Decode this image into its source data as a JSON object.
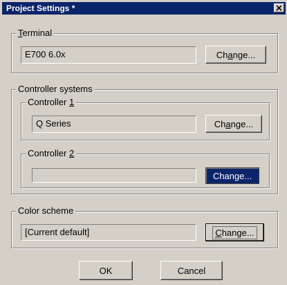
{
  "window": {
    "title": "Project Settings *",
    "close_icon": "close-icon"
  },
  "terminal": {
    "group_label_underlined": "T",
    "group_label_rest": "erminal",
    "value": "E700 6.0x",
    "change_label_pre": "Ch",
    "change_label_ul": "a",
    "change_label_post": "nge..."
  },
  "controller_systems": {
    "group_label": "Controller systems",
    "controller1": {
      "label_pre": "Controller ",
      "label_ul": "1",
      "value": "Q Series",
      "change_label_pre": "Ch",
      "change_label_ul": "a",
      "change_label_post": "nge..."
    },
    "controller2": {
      "label_pre": "Controller ",
      "label_ul": "2",
      "value": "",
      "change_label": "Change..."
    }
  },
  "color_scheme": {
    "group_label": "Color scheme",
    "value": "[Current default]",
    "change_label_pre": "",
    "change_label_ul": "C",
    "change_label_post": "hange..."
  },
  "footer": {
    "ok_label": "OK",
    "cancel_label": "Cancel"
  }
}
